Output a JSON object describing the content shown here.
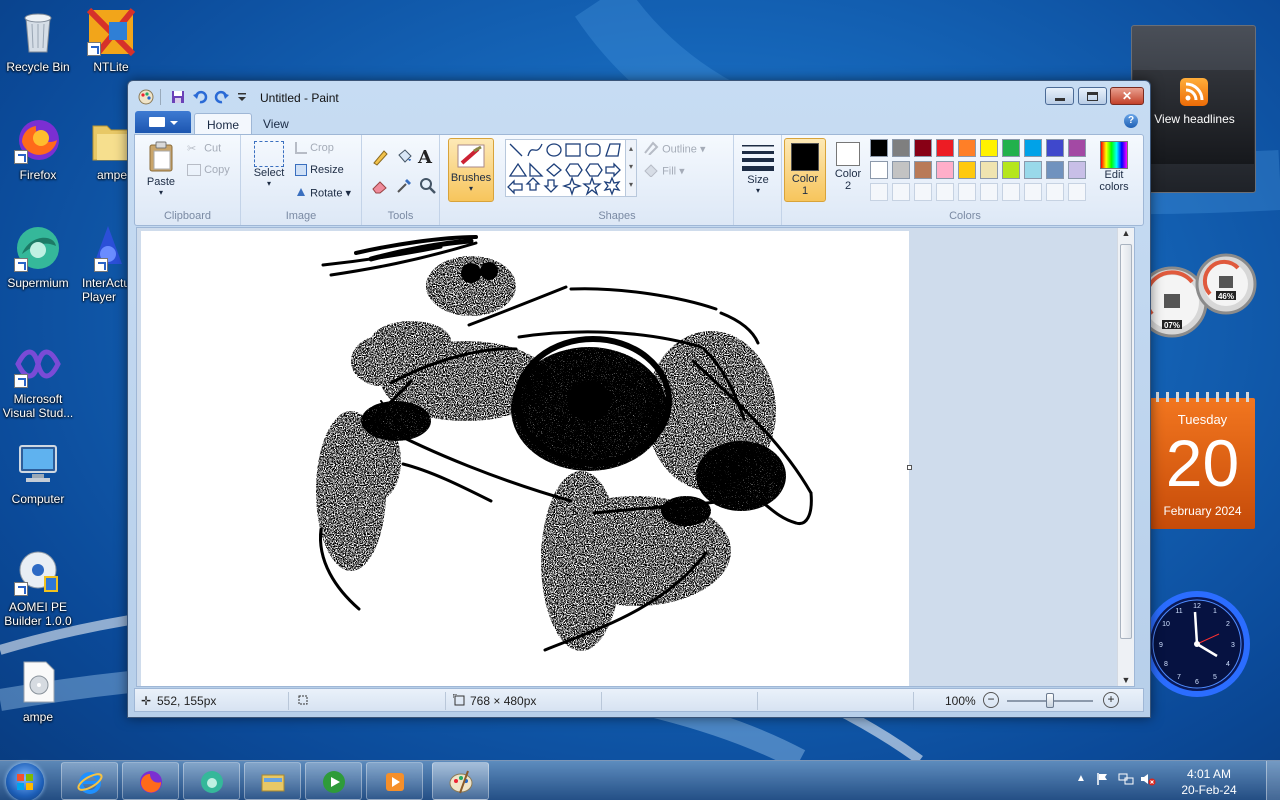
{
  "desktop_icons": [
    {
      "label": "Recycle Bin",
      "icon": "recycle-bin-icon"
    },
    {
      "label": "NTLite",
      "icon": "ntlite-icon"
    },
    {
      "label": "Firefox",
      "icon": "firefox-icon"
    },
    {
      "label": "ampe",
      "icon": "folder-icon"
    },
    {
      "label": "Supermium",
      "icon": "supermium-icon"
    },
    {
      "label": "InterActual Player",
      "icon": "interactual-icon"
    },
    {
      "label": "Microsoft Visual Stud...",
      "icon": "visual-studio-icon"
    },
    {
      "label": "Computer",
      "icon": "computer-icon"
    },
    {
      "label": "AOMEI PE Builder 1.0.0",
      "icon": "aomei-icon"
    },
    {
      "label": "ampe",
      "icon": "file-icon"
    }
  ],
  "gadgets": {
    "rss": {
      "label": "View headlines"
    },
    "cpu": {
      "cpu_percent": "07%",
      "ram_percent": "46%"
    },
    "calendar": {
      "weekday": "Tuesday",
      "day": "20",
      "month_year": "February 2024"
    }
  },
  "window": {
    "title": "Untitled - Paint",
    "tabs": [
      {
        "label": "Home",
        "active": true
      },
      {
        "label": "View",
        "active": false
      }
    ],
    "ribbon": {
      "clipboard": {
        "paste": "Paste",
        "cut": "Cut",
        "copy": "Copy",
        "group": "Clipboard"
      },
      "image": {
        "select": "Select",
        "crop": "Crop",
        "resize": "Resize",
        "rotate": "Rotate",
        "group": "Image"
      },
      "tools": {
        "group": "Tools"
      },
      "brushes": {
        "label": "Brushes"
      },
      "shapes": {
        "outline": "Outline",
        "fill": "Fill",
        "group": "Shapes"
      },
      "size": {
        "label": "Size"
      },
      "color1": {
        "label_a": "Color",
        "label_b": "1",
        "value": "#000000"
      },
      "color2": {
        "label_a": "Color",
        "label_b": "2",
        "value": "#ffffff"
      },
      "colors": {
        "group": "Colors",
        "edit_a": "Edit",
        "edit_b": "colors"
      },
      "palette": [
        "#000000",
        "#7f7f7f",
        "#880015",
        "#ed1c24",
        "#ff7f27",
        "#fff200",
        "#22b14c",
        "#00a2e8",
        "#3f48cc",
        "#a349a4",
        "#ffffff",
        "#c3c3c3",
        "#b97a57",
        "#ffaec9",
        "#ffc90e",
        "#efe4b0",
        "#b5e61d",
        "#99d9ea",
        "#7092be",
        "#c8bfe7"
      ]
    },
    "status": {
      "cursor_pos": "552, 155px",
      "canvas_size": "768 × 480px",
      "zoom": "100%"
    }
  },
  "taskbar": {
    "buttons": [
      "internet-explorer-icon",
      "firefox-icon",
      "supermium-icon",
      "file-explorer-icon",
      "media-player-icon",
      "media-center-icon",
      "paint-icon"
    ],
    "time": "4:01 AM",
    "date": "20-Feb-24"
  }
}
